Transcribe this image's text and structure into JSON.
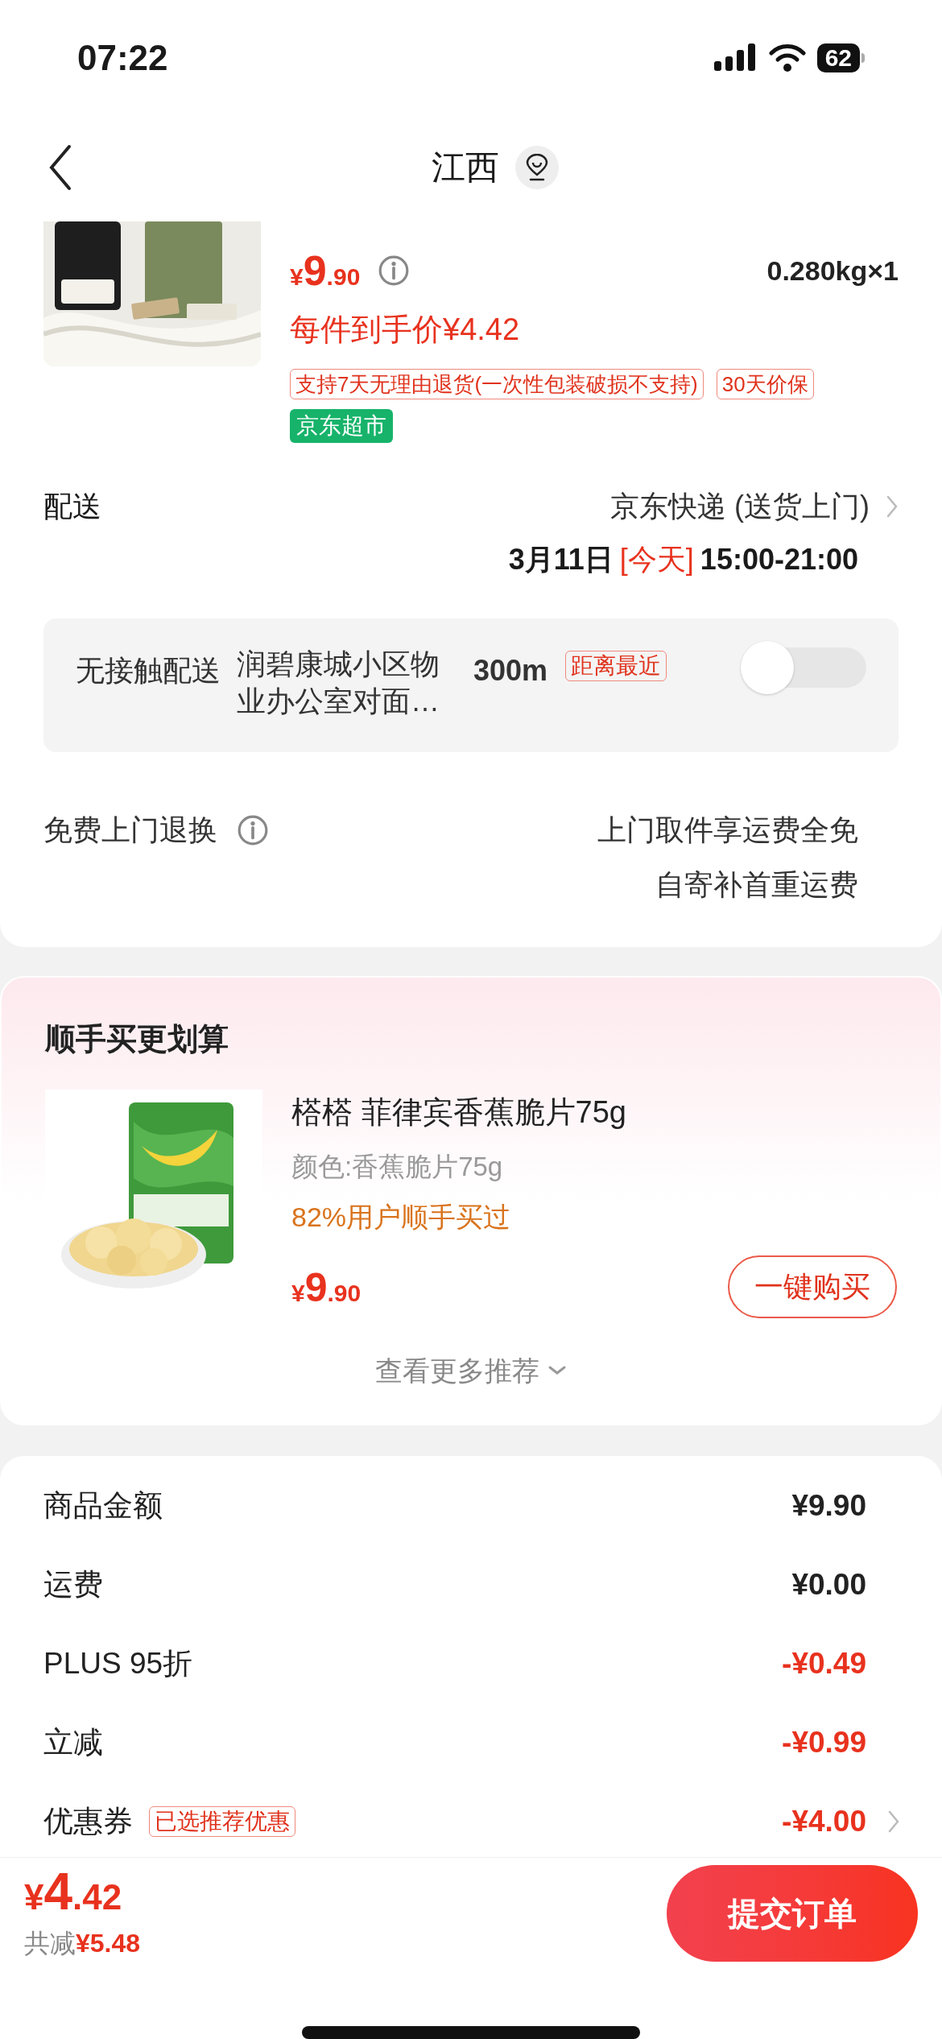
{
  "status_bar": {
    "time": "07:22",
    "battery": "62"
  },
  "header": {
    "title": "江西"
  },
  "product": {
    "price": {
      "currency": "¥",
      "integer": "9",
      "decimal": ".90"
    },
    "quantity": "0.280kg×1",
    "net_price": "每件到手价¥4.42",
    "tags": [
      "支持7天无理由退货(一次性包装破损不支持)",
      "30天价保"
    ],
    "store_badge": "京东超市"
  },
  "delivery": {
    "label": "配送",
    "method": "京东快递 (送货上门)",
    "date": "3月11日",
    "today": "[今天]",
    "time": "15:00-21:00"
  },
  "contactless": {
    "label": "无接触配送",
    "address": "润碧康城小区物业办公室对面…",
    "distance": "300m",
    "badge": "距离最近",
    "on": false
  },
  "return_service": {
    "label": "免费上门退换",
    "lines": [
      "上门取件享运费全免",
      "自寄补首重运费"
    ]
  },
  "recommend": {
    "title": "顺手买更划算",
    "item": {
      "name": "榙榙 菲律宾香蕉脆片75g",
      "spec": "颜色:香蕉脆片75g",
      "social": "82%用户顺手买过",
      "price": {
        "currency": "¥",
        "integer": "9",
        "decimal": ".90"
      }
    },
    "buy_button": "一键购买",
    "more": "查看更多推荐"
  },
  "summary": [
    {
      "label": "商品金额",
      "value": "¥9.90",
      "kind": "amount",
      "chevron": false
    },
    {
      "label": "运费",
      "value": "¥0.00",
      "kind": "amount",
      "chevron": false
    },
    {
      "label": "PLUS 95折",
      "value": "-¥0.49",
      "kind": "discount",
      "chevron": false
    },
    {
      "label": "立减",
      "value": "-¥0.99",
      "kind": "discount",
      "chevron": false
    },
    {
      "label": "优惠券",
      "tag": "已选推荐优惠",
      "value": "-¥4.00",
      "kind": "discount",
      "chevron": true
    }
  ],
  "bottom_bar": {
    "total": {
      "currency": "¥",
      "integer": "4",
      "decimal": ".42"
    },
    "saved_label": "共减",
    "saved_amount": "¥5.48",
    "submit": "提交订单"
  }
}
